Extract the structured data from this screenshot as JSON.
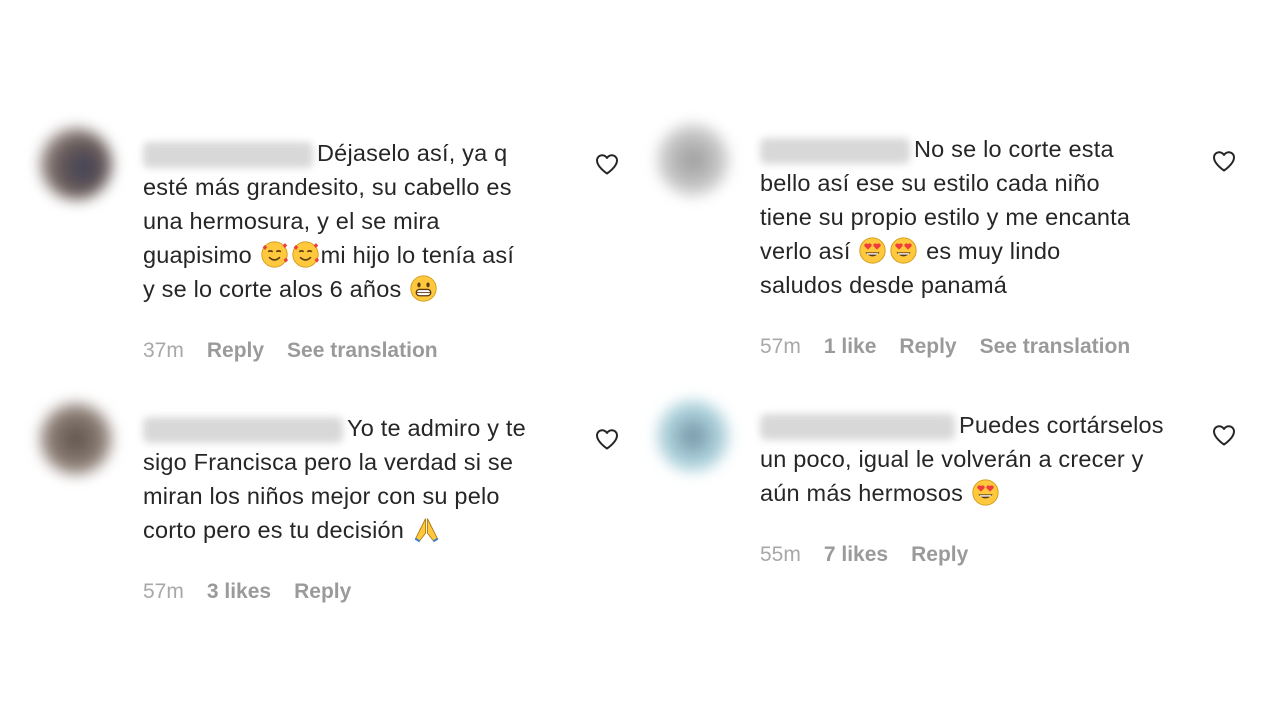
{
  "comments": [
    {
      "username": "cabellerocastillo",
      "avatar_color": "#5a5560",
      "lines": [
        "Déjaselo así, ya q",
        "esté más grandesito, su cabello es",
        "una hermosura, y el se mira",
        "guapisimo",
        "mi hijo lo tenía así",
        "y se lo corte alos 6 años"
      ],
      "time": "37m",
      "likes": "",
      "reply": "Reply",
      "translate": "See translation",
      "heart_icon": "heart-outline-icon"
    },
    {
      "username": "stephanyruiz",
      "avatar_color": "#b8b8b8",
      "lines": [
        "No se lo corte esta",
        "bello así ese su estilo cada niño",
        "tiene su propio estilo y me encanta",
        "verlo así",
        "es muy lindo",
        "saludos desde panamá"
      ],
      "time": "57m",
      "likes": "1 like",
      "reply": "Reply",
      "translate": "See translation",
      "heart_icon": "heart-outline-icon"
    },
    {
      "username": "isabelmendez7563",
      "avatar_color": "#7a6e68",
      "lines": [
        "Yo te admiro y te",
        "sigo Francisca pero la verdad si se",
        "miran los niños mejor con su pelo",
        "corto pero es tu decisión"
      ],
      "time": "57m",
      "likes": "3 likes",
      "reply": "Reply",
      "heart_icon": "heart-outline-icon"
    },
    {
      "username": "franciscabellasol",
      "avatar_color": "#a6cbd6",
      "lines": [
        "Puedes cortárselos",
        "un poco, igual le volverán a crecer y",
        "aún más hermosos"
      ],
      "time": "55m",
      "likes": "7 likes",
      "reply": "Reply",
      "heart_icon": "heart-outline-icon"
    }
  ],
  "colors": {
    "text": "#262626",
    "meta": "#a8a8a8",
    "emoji_face": "#FFC83D",
    "emoji_heart": "#F03C3C"
  }
}
